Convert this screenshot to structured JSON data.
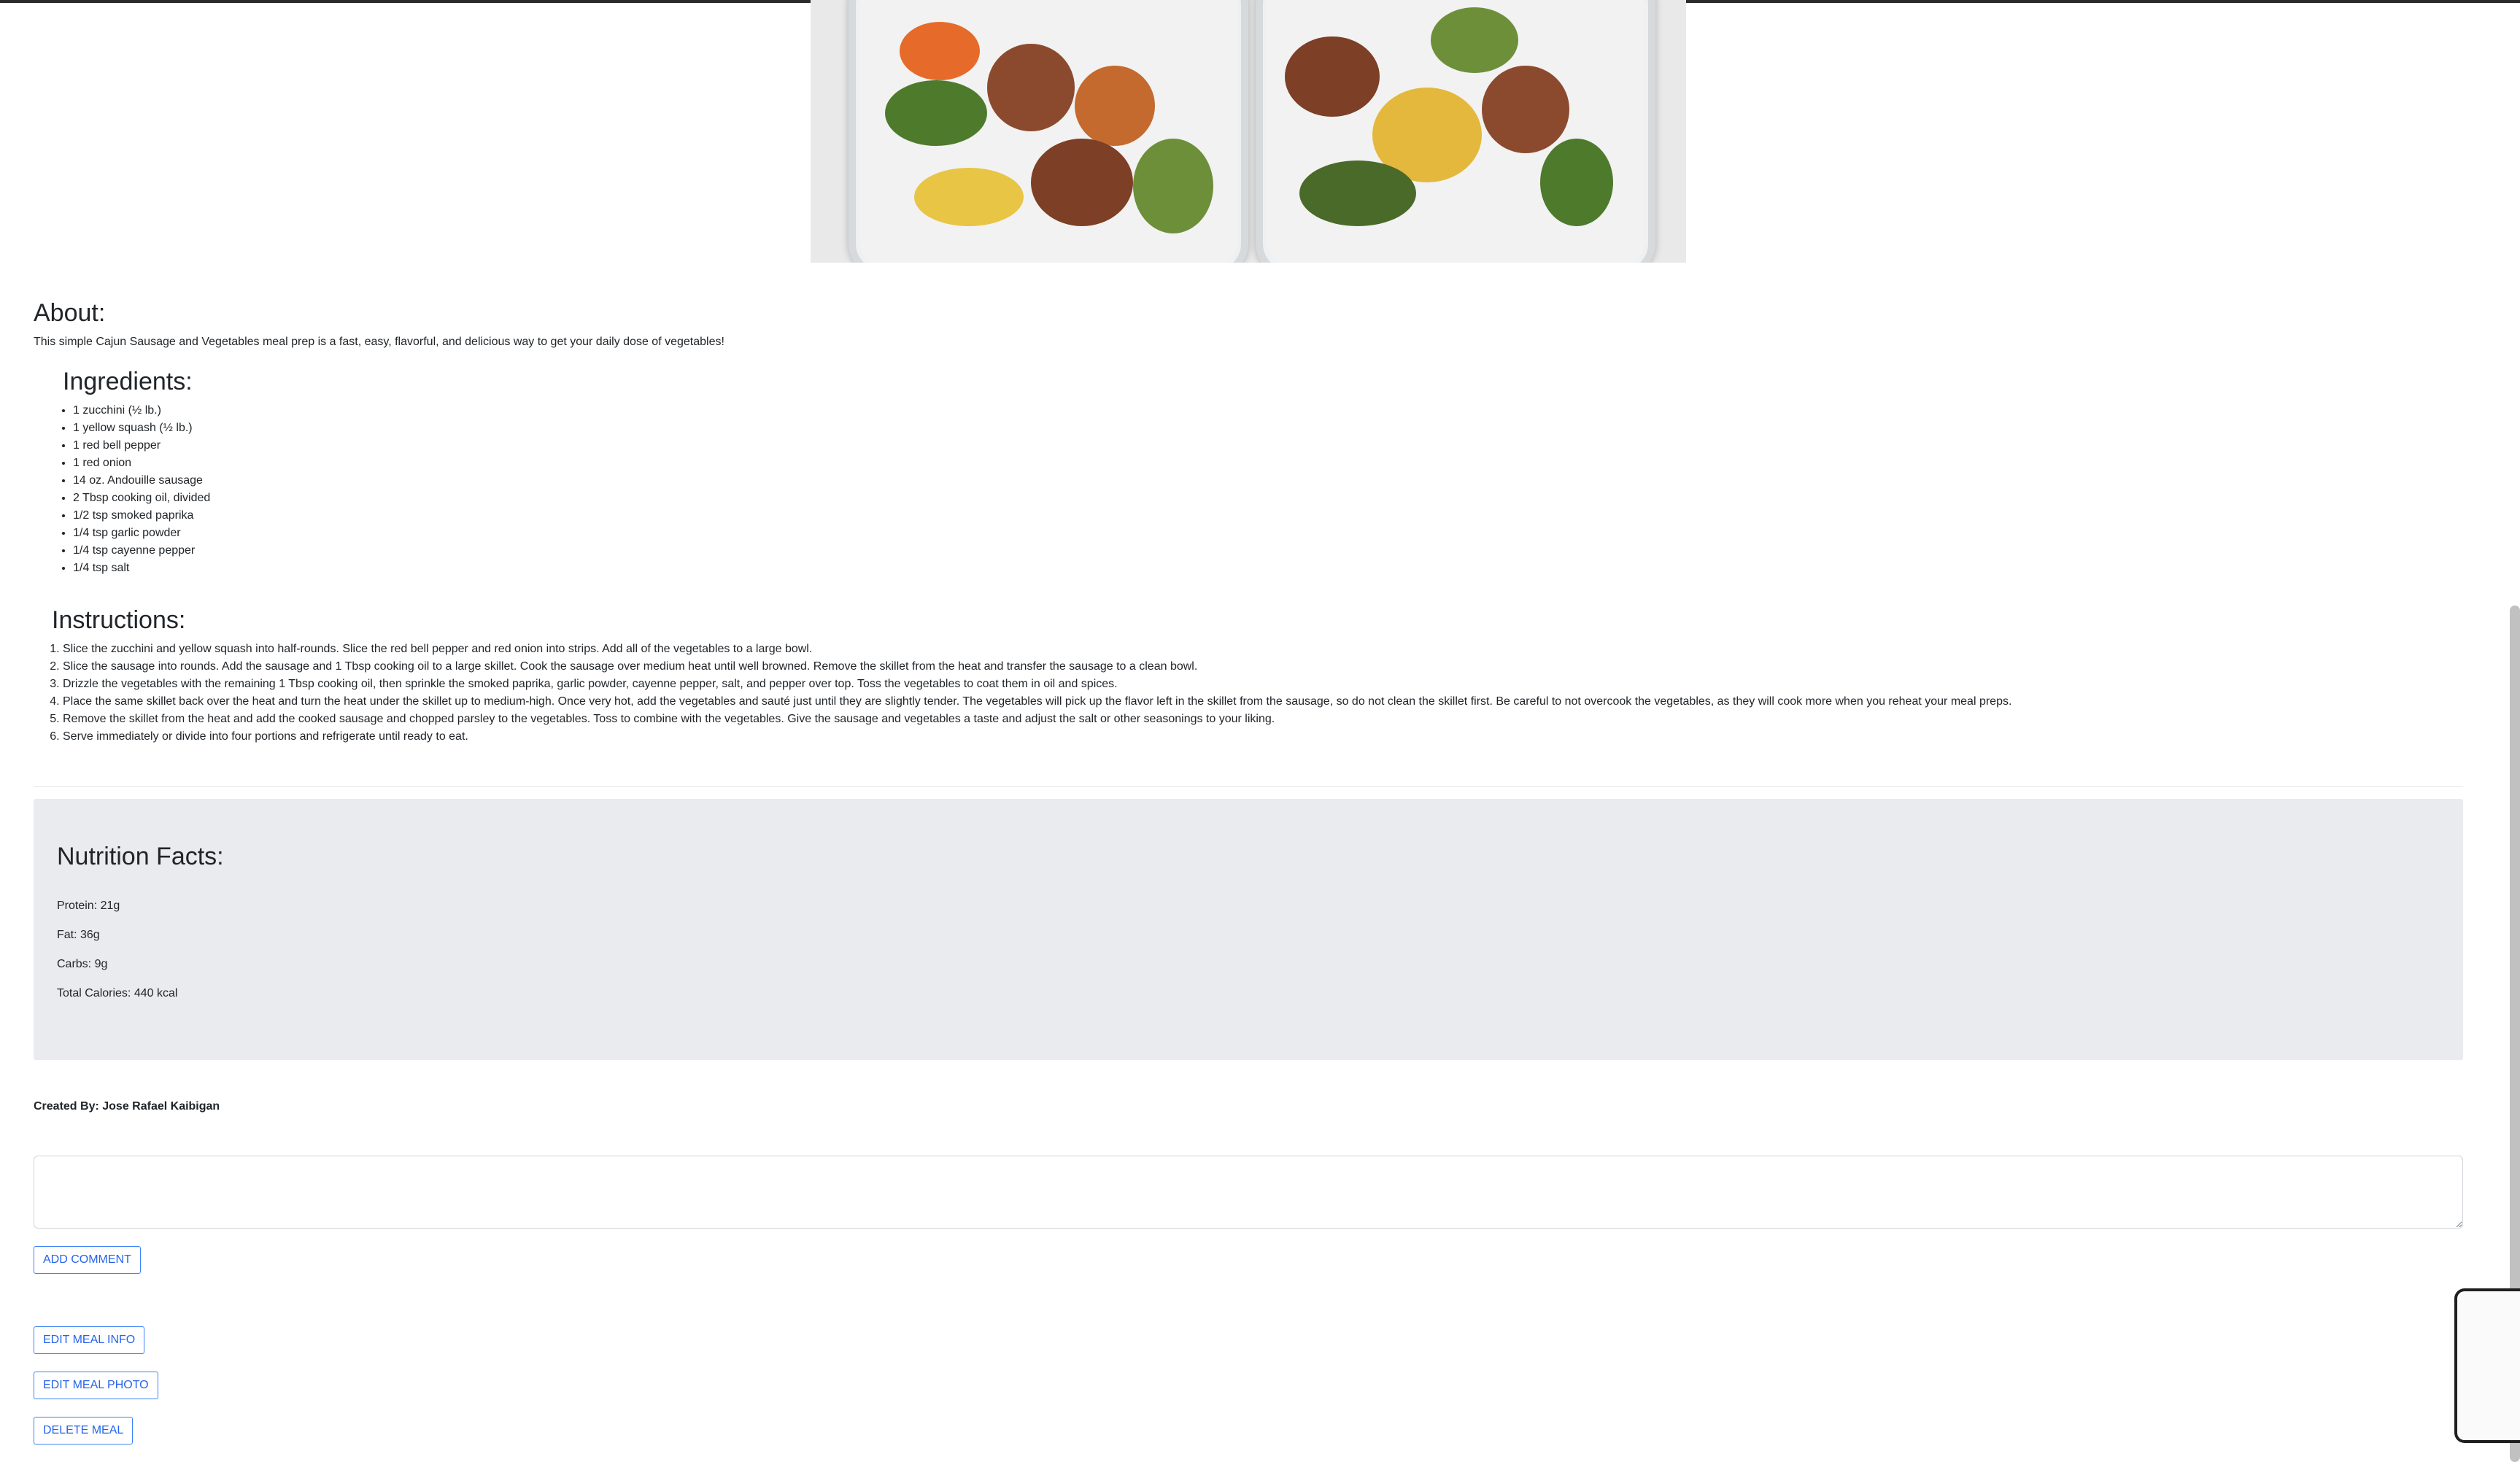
{
  "about": {
    "title": "About:",
    "text": "This simple Cajun Sausage and Vegetables meal prep is a fast, easy, flavorful, and delicious way to get your daily dose of vegetables!"
  },
  "ingredients": {
    "title": "Ingredients:",
    "items": [
      "1 zucchini (½ lb.)",
      "1 yellow squash (½ lb.)",
      "1 red bell pepper",
      "1 red onion",
      "14 oz. Andouille sausage",
      "2 Tbsp cooking oil, divided",
      "1/2 tsp smoked paprika",
      "1/4 tsp garlic powder",
      "1/4 tsp cayenne pepper",
      "1/4 tsp salt"
    ]
  },
  "instructions": {
    "title": "Instructions:",
    "steps": [
      "Slice the zucchini and yellow squash into half-rounds. Slice the red bell pepper and red onion into strips. Add all of the vegetables to a large bowl.",
      "Slice the sausage into rounds. Add the sausage and 1 Tbsp cooking oil to a large skillet. Cook the sausage over medium heat until well browned. Remove the skillet from the heat and transfer the sausage to a clean bowl.",
      "Drizzle the vegetables with the remaining 1 Tbsp cooking oil, then sprinkle the smoked paprika, garlic powder, cayenne pepper, salt, and pepper over top. Toss the vegetables to coat them in oil and spices.",
      "Place the same skillet back over the heat and turn the heat under the skillet up to medium-high. Once very hot, add the vegetables and sauté just until they are slightly tender. The vegetables will pick up the flavor left in the skillet from the sausage, so do not clean the skillet first. Be careful to not overcook the vegetables, as they will cook more when you reheat your meal preps.",
      "Remove the skillet from the heat and add the cooked sausage and chopped parsley to the vegetables. Toss to combine with the vegetables. Give the sausage and vegetables a taste and adjust the salt or other seasonings to your liking.",
      "Serve immediately or divide into four portions and refrigerate until ready to eat."
    ]
  },
  "nutrition": {
    "title": "Nutrition Facts:",
    "protein": "Protein: 21g",
    "fat": "Fat: 36g",
    "carbs": "Carbs: 9g",
    "calories": "Total Calories: 440 kcal"
  },
  "created_by": "Created By: Jose Rafael Kaibigan",
  "comment": {
    "value": "",
    "placeholder": ""
  },
  "buttons": {
    "add_comment": "ADD COMMENT",
    "edit_info": "EDIT MEAL INFO",
    "edit_photo": "EDIT MEAL PHOTO",
    "delete": "DELETE MEAL"
  },
  "colors": {
    "accent": "#2563eb",
    "nutrition_bg": "#e9ebee"
  }
}
